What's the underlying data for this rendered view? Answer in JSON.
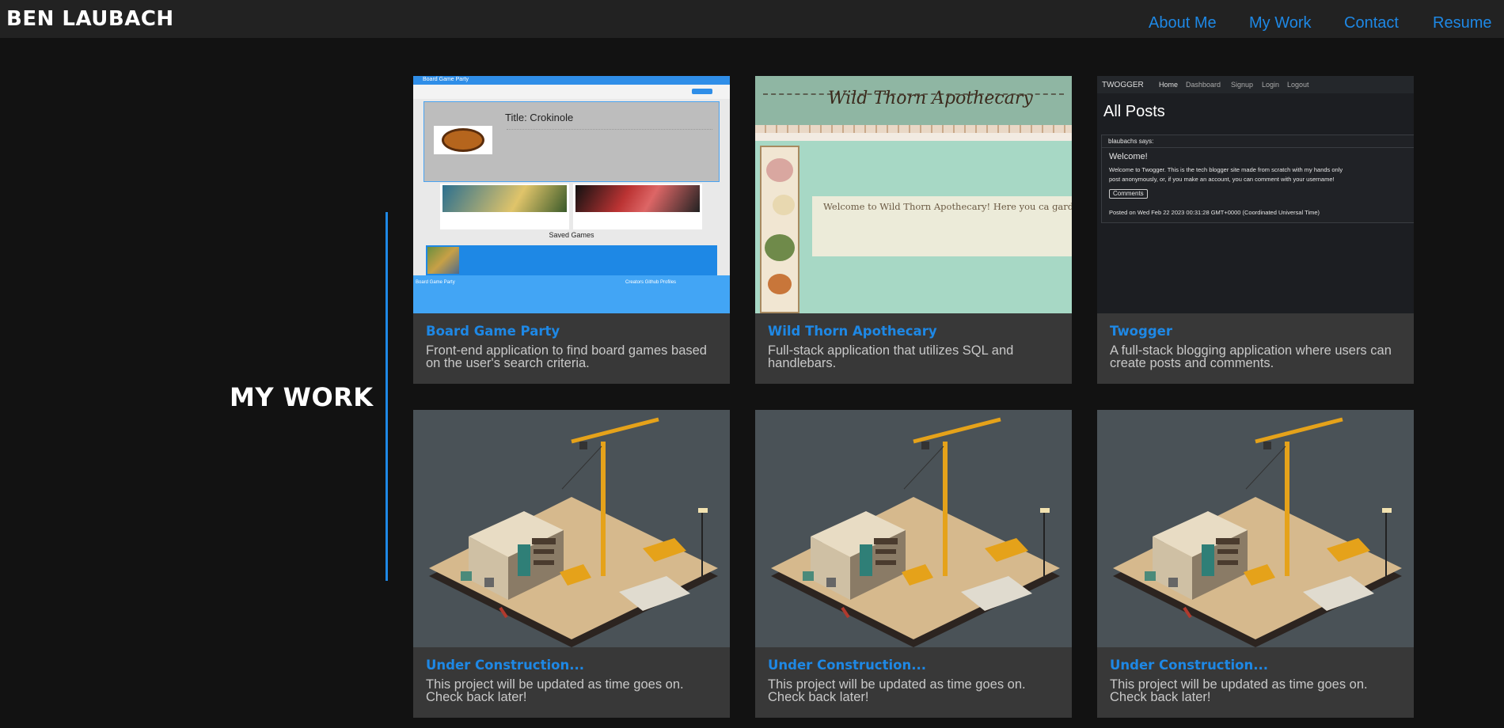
{
  "header": {
    "brand": "BEN LAUBACH",
    "nav": [
      {
        "label": "About Me"
      },
      {
        "label": "My Work"
      },
      {
        "label": "Contact"
      },
      {
        "label": "Resume"
      }
    ]
  },
  "section": {
    "title": "MY WORK"
  },
  "projects": [
    {
      "title": "Board Game Party",
      "description": "Front-end application to find board games based on the user's search criteria."
    },
    {
      "title": "Wild Thorn Apothecary",
      "description": "Full-stack application that utilizes SQL and handlebars."
    },
    {
      "title": "Twogger",
      "description": "A full-stack blogging application where users can create posts and comments."
    },
    {
      "title": "Under Construction...",
      "description": "This project will be updated as time goes on. Check back later!"
    },
    {
      "title": "Under Construction...",
      "description": "This project will be updated as time goes on. Check back later!"
    },
    {
      "title": "Under Construction...",
      "description": "This project will be updated as time goes on. Check back later!"
    }
  ],
  "thumbs": {
    "board_game": {
      "app_name": "Board Game Party",
      "game_title": "Title: Crokinole",
      "saved_heading": "Saved Games",
      "footer_left": "Board Game Party",
      "footer_right": "Creators Github Profiles"
    },
    "apothecary": {
      "banner": "Wild Thorn Apothecary",
      "welcome": "Welcome to Wild Thorn Apothecary! Here you ca garden. Choose any plants from within our datal help, what climate is best for them, and what t garden. You can search for plants and add thei your garden at home. Click the \"Start a Garden\""
    },
    "twogger": {
      "brand": "TWOGGER",
      "nav": [
        "Home",
        "Dashboard",
        "Signup",
        "Login",
        "Logout"
      ],
      "heading": "All Posts",
      "author": "blaubachs says:",
      "post_title": "Welcome!",
      "post_body_1": "Welcome to Twogger. This is the tech blogger site made from scratch with my hands only",
      "post_body_2": "post anonymously, or, if you make an account, you can comment with your username!",
      "comments_button": "Comments",
      "posted": "Posted on Wed Feb 22 2023 00:31:28 GMT+0000 (Coordinated Universal Time)"
    }
  },
  "colors": {
    "accent": "#1e88e5",
    "background": "#121212",
    "header": "#222222",
    "card": "#383838"
  }
}
